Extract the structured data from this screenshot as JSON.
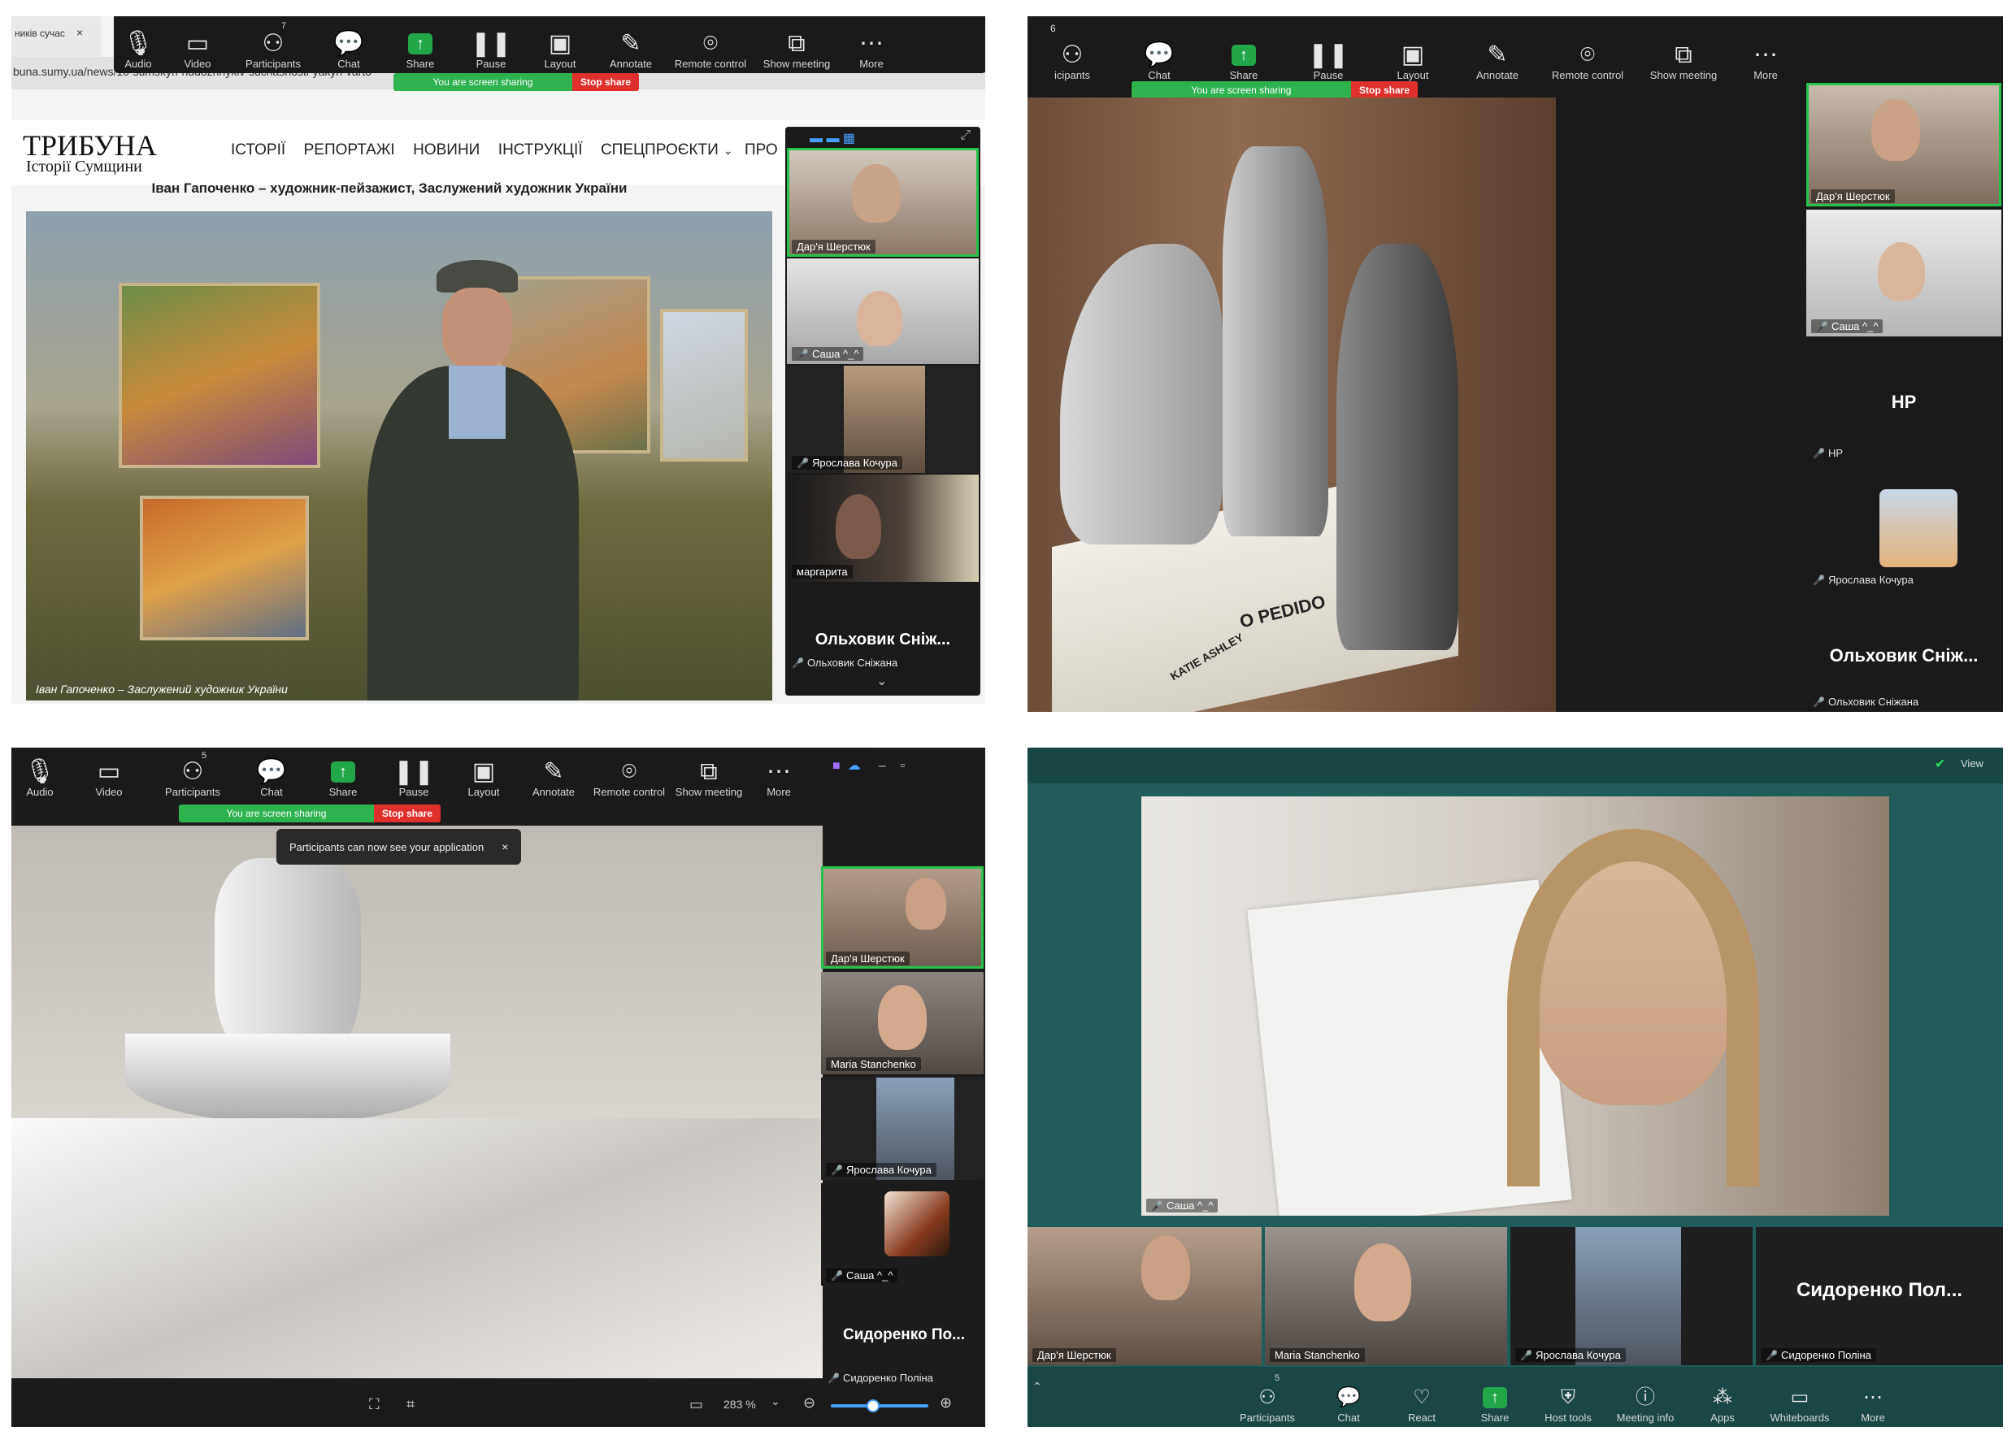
{
  "toolbar1": {
    "tab_title": "ників сучас",
    "url": "buna.sumy.ua/news/10-sumskyh-hudozhnykiv-suchasnosti-yakyh-varto",
    "participants_count": "7",
    "items": [
      "Audio",
      "Video",
      "Participants",
      "Chat",
      "Share",
      "Pause",
      "Layout",
      "Annotate",
      "Remote control",
      "Show meeting",
      "More"
    ]
  },
  "sharing": {
    "status": "You are screen sharing",
    "stop": "Stop share"
  },
  "website": {
    "logo": "ТРИБУНА",
    "logo_sub": "Історії Сумщини",
    "nav": [
      "ІСТОРІЇ",
      "РЕПОРТАЖІ",
      "НОВИНИ",
      "ІНСТРУКЦІЇ",
      "СПЕЦПРОЄКТИ",
      "ПРО"
    ],
    "headline": "Іван Гапоченко – художник-пейзажист, Заслужений художник України",
    "caption": "Іван Гапоченко – Заслужений художник України"
  },
  "panel1_participants": [
    {
      "name": "Дар'я Шерстюк"
    },
    {
      "name": "Саша ^_^"
    },
    {
      "name": "Ярослава Кочура"
    },
    {
      "name": "маргарита"
    }
  ],
  "panel1_bigname": "Ольховик Сніж...",
  "panel1_smallname": "Ольховик Сніжана",
  "toolbar2": {
    "participants_count": "6",
    "items": [
      "Participants",
      "Chat",
      "Share",
      "Pause",
      "Layout",
      "Annotate",
      "Remote control",
      "Show meeting",
      "More"
    ],
    "cut_label": "icipants"
  },
  "panel2_participants": [
    {
      "name": "Дар'я Шерстюк"
    },
    {
      "name": "Саша ^_^"
    }
  ],
  "panel2_hp_big": "HP",
  "panel2_hp_small": "HP",
  "panel2_yaroslava": "Ярослава Кочура",
  "panel2_bigname": "Ольховик Сніж...",
  "panel2_smallname": "Ольховик Сніжана",
  "book_text": {
    "a": "O PEDIDO",
    "b": "KATIE ASHLEY"
  },
  "toolbar3": {
    "participants_count": "5",
    "items": [
      "Audio",
      "Video",
      "Participants",
      "Chat",
      "Share",
      "Pause",
      "Layout",
      "Annotate",
      "Remote control",
      "Show meeting",
      "More"
    ]
  },
  "tooltip": "Participants can now see your application",
  "panel3_participants": [
    {
      "name": "Дар'я Шерстюк"
    },
    {
      "name": "Maria Stanchenko"
    },
    {
      "name": "Ярослава Кочура"
    },
    {
      "name": "Саша ^_^"
    }
  ],
  "panel3_bigname": "Сидоренко По...",
  "panel3_smallname": "Сидоренко Поліна",
  "panel3_zoom": "283 %",
  "panel4_view": "View",
  "panel4_main_name": "Саша ^_^",
  "panel4_strip": [
    {
      "name": "Дар'я Шерстюк"
    },
    {
      "name": "Maria Stanchenko"
    },
    {
      "name": "Ярослава Кочура"
    }
  ],
  "panel4_bigname": "Сидоренко  Пол...",
  "panel4_smallname": "Сидоренко Поліна",
  "toolbar4": {
    "participants_count": "5",
    "items": [
      "Participants",
      "Chat",
      "React",
      "Share",
      "Host tools",
      "Meeting info",
      "Apps",
      "Whiteboards",
      "More"
    ]
  },
  "colors": {
    "zoom_green": "#27c24c",
    "stop_red": "#e0302b",
    "toolbar": "#1a1a1a",
    "teal": "#1f5c5a"
  }
}
